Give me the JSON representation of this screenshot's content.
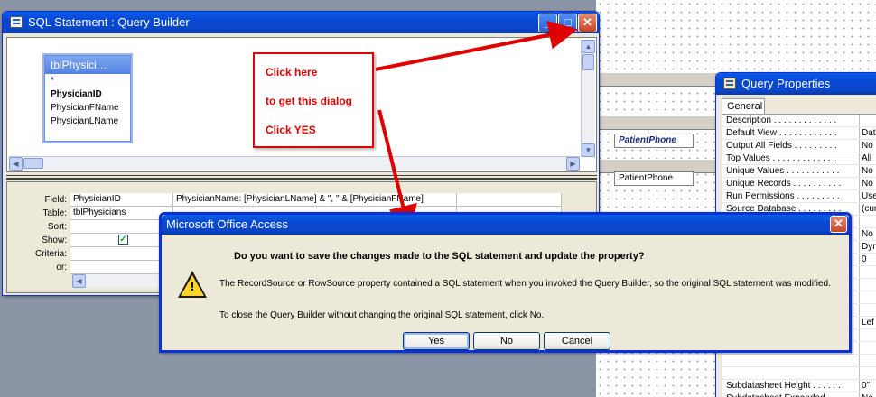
{
  "background": {
    "controls": [
      "PatientPhone",
      "PatientPhone"
    ]
  },
  "query_builder": {
    "title": "SQL Statement : Query Builder",
    "table_title": "tblPhysici…",
    "table_fields": [
      "*",
      "PhysicianID",
      "PhysicianFName",
      "PhysicianLName"
    ],
    "row_labels": [
      "Field:",
      "Table:",
      "Sort:",
      "Show:",
      "Criteria:",
      "or:"
    ],
    "grid": {
      "field": [
        "PhysicianID",
        "PhysicianName: [PhysicianLName] & \", \" & [PhysicianFName]"
      ],
      "table": [
        "tblPhysicians",
        ""
      ]
    }
  },
  "callout": {
    "line1": "Click here",
    "line2": "to get this dialog",
    "line3": "Click YES"
  },
  "query_properties": {
    "title": "Query Properties",
    "tab": "General",
    "rows": [
      {
        "name": "Description . . . . . . . . . . . . .",
        "value": ""
      },
      {
        "name": "Default View . . . . . . . . . . . .",
        "value": "Data"
      },
      {
        "name": "Output All Fields . . . . . . . . .",
        "value": "No"
      },
      {
        "name": "Top Values . . . . . . . . . . . . .",
        "value": "All"
      },
      {
        "name": "Unique Values . . . . . . . . . . .",
        "value": "No"
      },
      {
        "name": "Unique Records . . . . . . . . . .",
        "value": "No"
      },
      {
        "name": "Run Permissions . . . . . . . . .",
        "value": "User"
      },
      {
        "name": "Source Database . . . . . . . . .",
        "value": "(cur"
      },
      {
        "name": "",
        "value": ""
      },
      {
        "name": "",
        "value": "No"
      },
      {
        "name": "",
        "value": "Dyn"
      },
      {
        "name": "",
        "value": "0"
      },
      {
        "name": "",
        "value": ""
      },
      {
        "name": "",
        "value": ""
      },
      {
        "name": "",
        "value": ""
      },
      {
        "name": "",
        "value": ""
      },
      {
        "name": "",
        "value": "Lef"
      },
      {
        "name": "",
        "value": ""
      },
      {
        "name": "",
        "value": ""
      },
      {
        "name": "",
        "value": ""
      },
      {
        "name": "",
        "value": ""
      },
      {
        "name": "Subdatasheet Height . . . . . .",
        "value": "0\""
      },
      {
        "name": "Subdatasheet Expanded . . . .",
        "value": "No"
      }
    ]
  },
  "dialog": {
    "title": "Microsoft Office Access",
    "question": "Do you want to save the changes made to the SQL statement and update the property?",
    "body1": "The RecordSource or RowSource property contained a SQL statement when you invoked the Query Builder, so the original SQL statement was modified.",
    "body2": "To close the Query Builder without changing the original SQL statement, click No.",
    "buttons": {
      "yes": "Yes",
      "no": "No",
      "cancel": "Cancel"
    }
  },
  "colors": {
    "accent": "#0a45c9",
    "callout_red": "#e00000",
    "warning_yellow": "#ffd42a"
  }
}
